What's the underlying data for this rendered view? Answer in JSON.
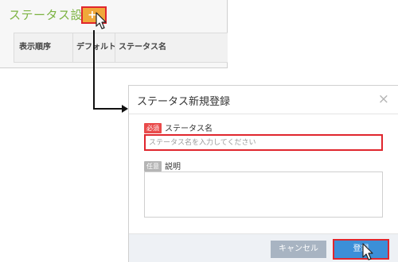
{
  "list_panel": {
    "title": "ステータス設定",
    "add_button_glyph": "+",
    "columns": [
      "表示順序",
      "デフォルト",
      "ステータス名"
    ]
  },
  "modal": {
    "title": "ステータス新規登録",
    "close_glyph": "×",
    "name_field": {
      "badge": "必須",
      "label": "ステータス名",
      "value": "",
      "placeholder": "ステータス名を入力してください"
    },
    "description_field": {
      "badge": "任意",
      "label": "説明",
      "value": ""
    },
    "buttons": {
      "cancel": "キャンセル",
      "register": "登録"
    }
  },
  "colors": {
    "title_green": "#7cb342",
    "highlight_red": "#e0262d",
    "add_button_orange": "#f0a83a",
    "required_badge": "#e94b4b",
    "optional_badge": "#b5b5b5",
    "register_blue": "#3c8fd8",
    "cancel_gray": "#a8b4c2"
  },
  "icons": {
    "cursor": "pointer-cursor-icon",
    "connector": "arrow-right-icon",
    "close": "close-icon",
    "add": "plus-icon"
  }
}
